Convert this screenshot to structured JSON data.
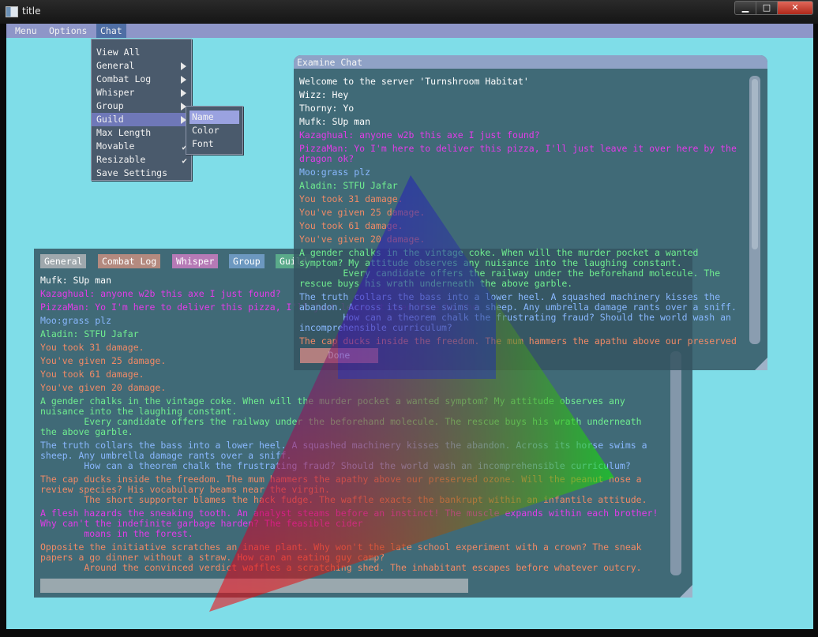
{
  "window": {
    "title": "title",
    "controls": {
      "minimize": "▁",
      "maximize": "□",
      "close": "✕"
    }
  },
  "menubar": {
    "items": [
      "Menu",
      "Options",
      "Chat"
    ],
    "active": "Chat"
  },
  "chat_menu": {
    "items": [
      "View All",
      "General",
      "Combat Log",
      "Whisper",
      "Group",
      "Guild",
      "Max Length",
      "Movable",
      "Resizable",
      "Save Settings"
    ],
    "submenu_items": [
      "General",
      "Combat Log",
      "Whisper",
      "Group",
      "Guild"
    ],
    "checked_items": [
      "Movable",
      "Resizable"
    ],
    "highlighted": "Guild",
    "guild_submenu": {
      "items": [
        "Name",
        "Color",
        "Font"
      ],
      "highlighted": "Name"
    }
  },
  "colors": {
    "background": "#7fdde8",
    "menubar": "#8e96c8",
    "white": "#ffffff",
    "magenta": "#e23ce8",
    "blue": "#89b8ff",
    "green": "#70ee90",
    "orange": "#f08a66",
    "tab_general": "#9fa8ad",
    "tab_combat": "#b48a7f",
    "tab_whisper": "#b67ab6",
    "tab_group": "#6c98c0",
    "tab_guild": "#5aaa8a"
  },
  "examine_chat": {
    "title": "Examine Chat",
    "done_label": "Done",
    "lines": [
      {
        "text": "Welcome to the server 'Turnshroom Habitat'",
        "color": "white"
      },
      {
        "text": "Wizz: Hey",
        "color": "white"
      },
      {
        "text": "Thorny: Yo",
        "color": "white"
      },
      {
        "text": "Mufk: SUp man",
        "color": "white"
      },
      {
        "text": "Kazaghual: anyone w2b this axe I just found?",
        "color": "magenta"
      },
      {
        "text": "PizzaMan: Yo I'm here to deliver this pizza, I'll just leave it over here by the",
        "color": "magenta"
      },
      {
        "text": "dragon ok?",
        "color": "magenta"
      },
      {
        "text": "Moo:grass plz",
        "color": "blue"
      },
      {
        "text": "Aladin: STFU Jafar",
        "color": "green"
      },
      {
        "text": "You took 31 damage.",
        "color": "orange"
      },
      {
        "text": "You've given 25 damage.",
        "color": "orange"
      },
      {
        "text": "You took 61 damage.",
        "color": "orange"
      },
      {
        "text": "You've given 20 damage.",
        "color": "orange"
      },
      {
        "text": "A gender chalks in the vintage coke. When will the murder pocket a wanted",
        "color": "green"
      },
      {
        "text": "symptom? My attitude observes any nuisance into the laughing constant.",
        "color": "green"
      },
      {
        "text": "        Every candidate offers the railway under the beforehand molecule. The",
        "color": "green"
      },
      {
        "text": "rescue buys his wrath underneath the above garble.",
        "color": "green"
      },
      {
        "text": "The truth collars the bass into a lower heel. A squashed machinery kisses the",
        "color": "blue"
      },
      {
        "text": "abandon. Across its horse swims a sheep. Any umbrella damage rants over a sniff.",
        "color": "blue"
      },
      {
        "text": "        How can a theorem chalk the frustrating fraud? Should the world wash an",
        "color": "blue"
      },
      {
        "text": "incomprehensible curriculum?",
        "color": "blue"
      },
      {
        "text": "The cap ducks inside the freedom. The mum hammers the apathu above our preserved",
        "color": "orange"
      }
    ]
  },
  "chat_window": {
    "tabs": [
      "General",
      "Combat Log",
      "Whisper",
      "Group",
      "Guild"
    ],
    "lines": [
      {
        "text": "Mufk: SUp man",
        "color": "white"
      },
      {
        "text": "Kazaghual: anyone w2b this axe I just found?",
        "color": "magenta"
      },
      {
        "text": "PizzaMan: Yo I'm here to deliver this pizza, I'll just leave it over here by the",
        "color": "magenta"
      },
      {
        "text": "Moo:grass plz",
        "color": "blue"
      },
      {
        "text": "Aladin: STFU Jafar",
        "color": "green"
      },
      {
        "text": "You took 31 damage.",
        "color": "orange"
      },
      {
        "text": "You've given 25 damage.",
        "color": "orange"
      },
      {
        "text": "You took 61 damage.",
        "color": "orange"
      },
      {
        "text": "You've given 20 damage.",
        "color": "orange"
      },
      {
        "text": "A gender chalks in the vintage coke. When will the murder pocket a wanted symptom? My attitude observes any",
        "color": "green"
      },
      {
        "text": "nuisance into the laughing constant.",
        "color": "green"
      },
      {
        "text": "        Every candidate offers the railway under the beforehand molecule. The rescue buys his wrath underneath",
        "color": "green"
      },
      {
        "text": "the above garble.",
        "color": "green"
      },
      {
        "text": "The truth collars the bass into a lower heel. A squashed machinery kisses the abandon. Across its horse swims a",
        "color": "blue"
      },
      {
        "text": "sheep. Any umbrella damage rants over a sniff.",
        "color": "blue"
      },
      {
        "text": "        How can a theorem chalk the frustrating fraud? Should the world wash an incomprehensible curriculum?",
        "color": "blue"
      },
      {
        "text": "The cap ducks inside the freedom. The mum hammers the apathy above our preserved ozone. Will the peanut nose a",
        "color": "orange"
      },
      {
        "text": "review species? His vocabulary beams near the virgin.",
        "color": "orange"
      },
      {
        "text": "        The short supporter blames the hack fudge. The waffle exacts the bankrupt within an infantile attitude.",
        "color": "orange"
      },
      {
        "text": "A flesh hazards the sneaking tooth. An analyst steams before an instinct! The muscle expands within each brother!",
        "color": "magenta"
      },
      {
        "text": "Why can't the indefinite garbage harden? The feasible cider",
        "color": "magenta"
      },
      {
        "text": "        moans in the forest.",
        "color": "magenta"
      },
      {
        "text": "Opposite the initiative scratches an inane plant. Why won't the late school experiment with a crown? The sneak",
        "color": "orange"
      },
      {
        "text": "papers a go dinner without a straw. How can an eating guy camp?",
        "color": "orange"
      },
      {
        "text": "        Around the convinced verdict waffles a scratching shed. The inhabitant escapes before whatever outcry.",
        "color": "orange"
      }
    ]
  }
}
